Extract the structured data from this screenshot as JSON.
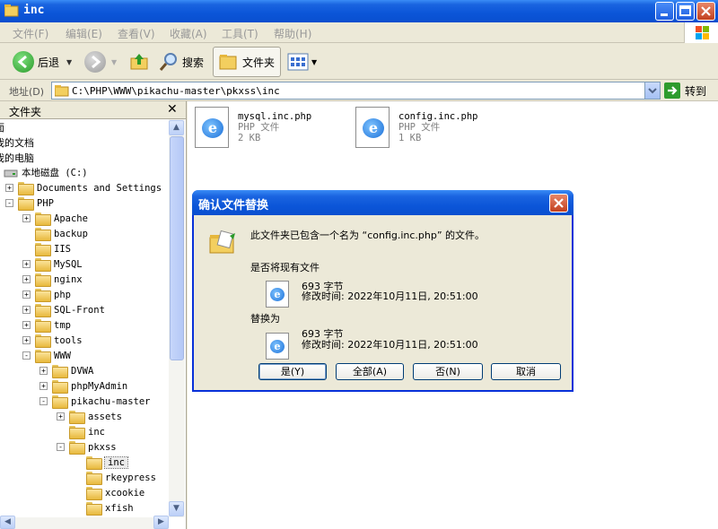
{
  "window": {
    "title": "inc"
  },
  "menu": [
    "文件(F)",
    "编辑(E)",
    "查看(V)",
    "收藏(A)",
    "工具(T)",
    "帮助(H)"
  ],
  "toolbar": {
    "back": "后退",
    "search": "搜索",
    "folders": "文件夹"
  },
  "address": {
    "label": "地址(D)",
    "value": "C:\\PHP\\WWW\\pikachu-master\\pkxss\\inc",
    "go": "转到"
  },
  "folder_pane": {
    "title": "文件夹",
    "nodes": [
      {
        "label": "面",
        "depth": 0,
        "exp": "",
        "folder": false
      },
      {
        "label": "我的文档",
        "depth": 0,
        "exp": "",
        "folder": false
      },
      {
        "label": "我的电脑",
        "depth": 0,
        "exp": "",
        "folder": false
      },
      {
        "label": "本地磁盘 (C:)",
        "depth": 0,
        "exp": "",
        "folder": false,
        "drive": true
      },
      {
        "label": "Documents and Settings",
        "depth": 1,
        "exp": "+",
        "folder": true
      },
      {
        "label": "PHP",
        "depth": 1,
        "exp": "-",
        "folder": true
      },
      {
        "label": "Apache",
        "depth": 2,
        "exp": "+",
        "folder": true
      },
      {
        "label": "backup",
        "depth": 2,
        "exp": "",
        "folder": true
      },
      {
        "label": "IIS",
        "depth": 2,
        "exp": "",
        "folder": true
      },
      {
        "label": "MySQL",
        "depth": 2,
        "exp": "+",
        "folder": true
      },
      {
        "label": "nginx",
        "depth": 2,
        "exp": "+",
        "folder": true
      },
      {
        "label": "php",
        "depth": 2,
        "exp": "+",
        "folder": true
      },
      {
        "label": "SQL-Front",
        "depth": 2,
        "exp": "+",
        "folder": true
      },
      {
        "label": "tmp",
        "depth": 2,
        "exp": "+",
        "folder": true
      },
      {
        "label": "tools",
        "depth": 2,
        "exp": "+",
        "folder": true
      },
      {
        "label": "WWW",
        "depth": 2,
        "exp": "-",
        "folder": true
      },
      {
        "label": "DVWA",
        "depth": 3,
        "exp": "+",
        "folder": true
      },
      {
        "label": "phpMyAdmin",
        "depth": 3,
        "exp": "+",
        "folder": true
      },
      {
        "label": "pikachu-master",
        "depth": 3,
        "exp": "-",
        "folder": true
      },
      {
        "label": "assets",
        "depth": 4,
        "exp": "+",
        "folder": true
      },
      {
        "label": "inc",
        "depth": 4,
        "exp": "",
        "folder": true
      },
      {
        "label": "pkxss",
        "depth": 4,
        "exp": "-",
        "folder": true
      },
      {
        "label": "inc",
        "depth": 5,
        "exp": "",
        "folder": true,
        "selected": true
      },
      {
        "label": "rkeypress",
        "depth": 5,
        "exp": "",
        "folder": true
      },
      {
        "label": "xcookie",
        "depth": 5,
        "exp": "",
        "folder": true
      },
      {
        "label": "xfish",
        "depth": 5,
        "exp": "",
        "folder": true
      }
    ]
  },
  "files": [
    {
      "name": "mysql.inc.php",
      "type": "PHP 文件",
      "size": "2 KB"
    },
    {
      "name": "config.inc.php",
      "type": "PHP 文件",
      "size": "1 KB"
    }
  ],
  "dialog": {
    "title": "确认文件替换",
    "message": "此文件夹已包含一个名为 “config.inc.php” 的文件。",
    "question": "是否将现有文件",
    "existing": {
      "size": "693 字节",
      "modified": "修改时间: 2022年10月11日, 20:51:00"
    },
    "replace_with": "替换为",
    "new": {
      "size": "693 字节",
      "modified": "修改时间: 2022年10月11日, 20:51:00"
    },
    "buttons": {
      "yes": "是(Y)",
      "all": "全部(A)",
      "no": "否(N)",
      "cancel": "取消"
    }
  }
}
